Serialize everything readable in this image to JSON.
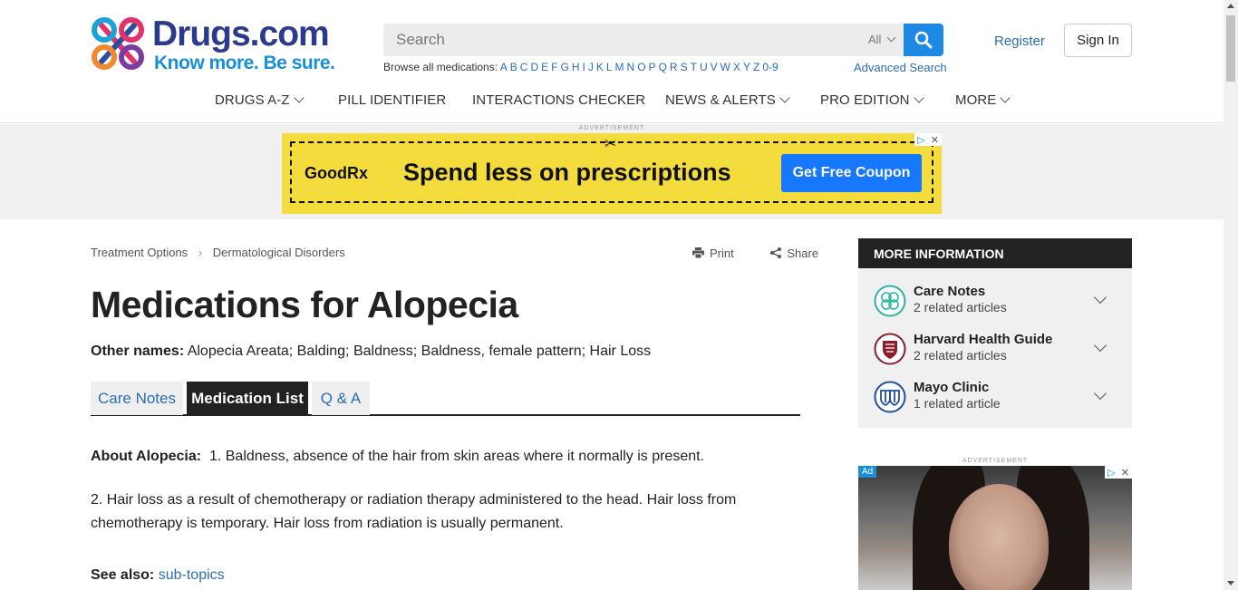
{
  "brand": {
    "name": "Drugs.com",
    "tagline": "Know more. Be sure."
  },
  "search": {
    "placeholder": "Search",
    "scope": "All",
    "browse_label": "Browse all medications:",
    "letters": [
      "A",
      "B",
      "C",
      "D",
      "E",
      "F",
      "G",
      "H",
      "I",
      "J",
      "K",
      "L",
      "M",
      "N",
      "O",
      "P",
      "Q",
      "R",
      "S",
      "T",
      "U",
      "V",
      "W",
      "X",
      "Y",
      "Z",
      "0-9"
    ],
    "advanced": "Advanced Search"
  },
  "account": {
    "register": "Register",
    "signin": "Sign In"
  },
  "nav": {
    "items": [
      {
        "label": "DRUGS A-Z",
        "dropdown": true
      },
      {
        "label": "PILL IDENTIFIER",
        "dropdown": false
      },
      {
        "label": "INTERACTIONS CHECKER",
        "dropdown": false
      },
      {
        "label": "NEWS & ALERTS",
        "dropdown": true
      },
      {
        "label": "PRO EDITION",
        "dropdown": true
      },
      {
        "label": "MORE",
        "dropdown": true
      }
    ]
  },
  "ad_banner": {
    "label": "ADVERTISEMENT",
    "brand": "GoodRx",
    "headline": "Spend less on prescriptions",
    "cta": "Get Free Coupon"
  },
  "breadcrumb": [
    "Treatment Options",
    "Dermatological Disorders"
  ],
  "tools": {
    "print": "Print",
    "share": "Share"
  },
  "page": {
    "title": "Medications for Alopecia",
    "other_names_label": "Other names:",
    "other_names": "Alopecia Areata; Balding; Baldness; Baldness, female pattern; Hair Loss"
  },
  "tabs": [
    {
      "label": "Care Notes",
      "active": false
    },
    {
      "label": "Medication List",
      "active": true
    },
    {
      "label": "Q & A",
      "active": false
    }
  ],
  "about": {
    "label": "About Alopecia:",
    "p1": "1. Baldness, absence of the hair from skin areas where it normally is present.",
    "p2": "2. Hair loss as a result of chemotherapy or radiation therapy administered to the head. Hair loss from chemotherapy is temporary. Hair loss from radiation is usually permanent.",
    "see_also_label": "See also:",
    "see_also_link": "sub-topics"
  },
  "more_info": {
    "title": "MORE INFORMATION",
    "items": [
      {
        "title": "Care Notes",
        "sub": "2 related articles",
        "icon": "care-notes-icon"
      },
      {
        "title": "Harvard Health Guide",
        "sub": "2 related articles",
        "icon": "harvard-shield-icon"
      },
      {
        "title": "Mayo Clinic",
        "sub": "1 related article",
        "icon": "mayo-shield-icon"
      }
    ]
  },
  "sidebar_ad": {
    "label": "ADVERTISEMENT",
    "tag": "Ad"
  },
  "colors": {
    "accent": "#1e88e5",
    "link": "#2a6db8",
    "brand_dark": "#2b3a8c",
    "ad_yellow": "#f5dc3d"
  }
}
